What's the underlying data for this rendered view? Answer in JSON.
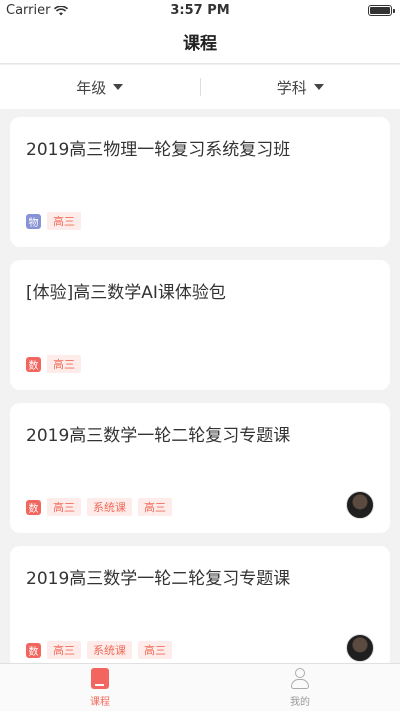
{
  "status": {
    "carrier": "Carrier",
    "time": "3:57 PM"
  },
  "nav": {
    "title": "课程"
  },
  "filters": [
    {
      "label": "年级"
    },
    {
      "label": "学科"
    }
  ],
  "courses": [
    {
      "title": "2019高三物理一轮复习系统复习班",
      "subject_icon": "物",
      "subject_color": "#8793d6",
      "tags": [
        "高三"
      ],
      "has_avatar": false
    },
    {
      "title": "[体验]高三数学AI课体验包",
      "subject_icon": "数",
      "subject_color": "#f2665f",
      "tags": [
        "高三"
      ],
      "has_avatar": false
    },
    {
      "title": "2019高三数学一轮二轮复习专题课",
      "subject_icon": "数",
      "subject_color": "#f2665f",
      "tags": [
        "高三",
        "系统课",
        "高三"
      ],
      "has_avatar": true
    },
    {
      "title": "2019高三数学一轮二轮复习专题课",
      "subject_icon": "数",
      "subject_color": "#f2665f",
      "tags": [
        "高三",
        "系统课",
        "高三"
      ],
      "has_avatar": true
    }
  ],
  "tabbar": [
    {
      "label": "课程",
      "icon": "book-icon",
      "active": true
    },
    {
      "label": "我的",
      "icon": "person-icon",
      "active": false
    }
  ],
  "colors": {
    "accent": "#f26b5a",
    "tag_bg": "#fdecea",
    "physics": "#8793d6",
    "math": "#f2665f"
  }
}
